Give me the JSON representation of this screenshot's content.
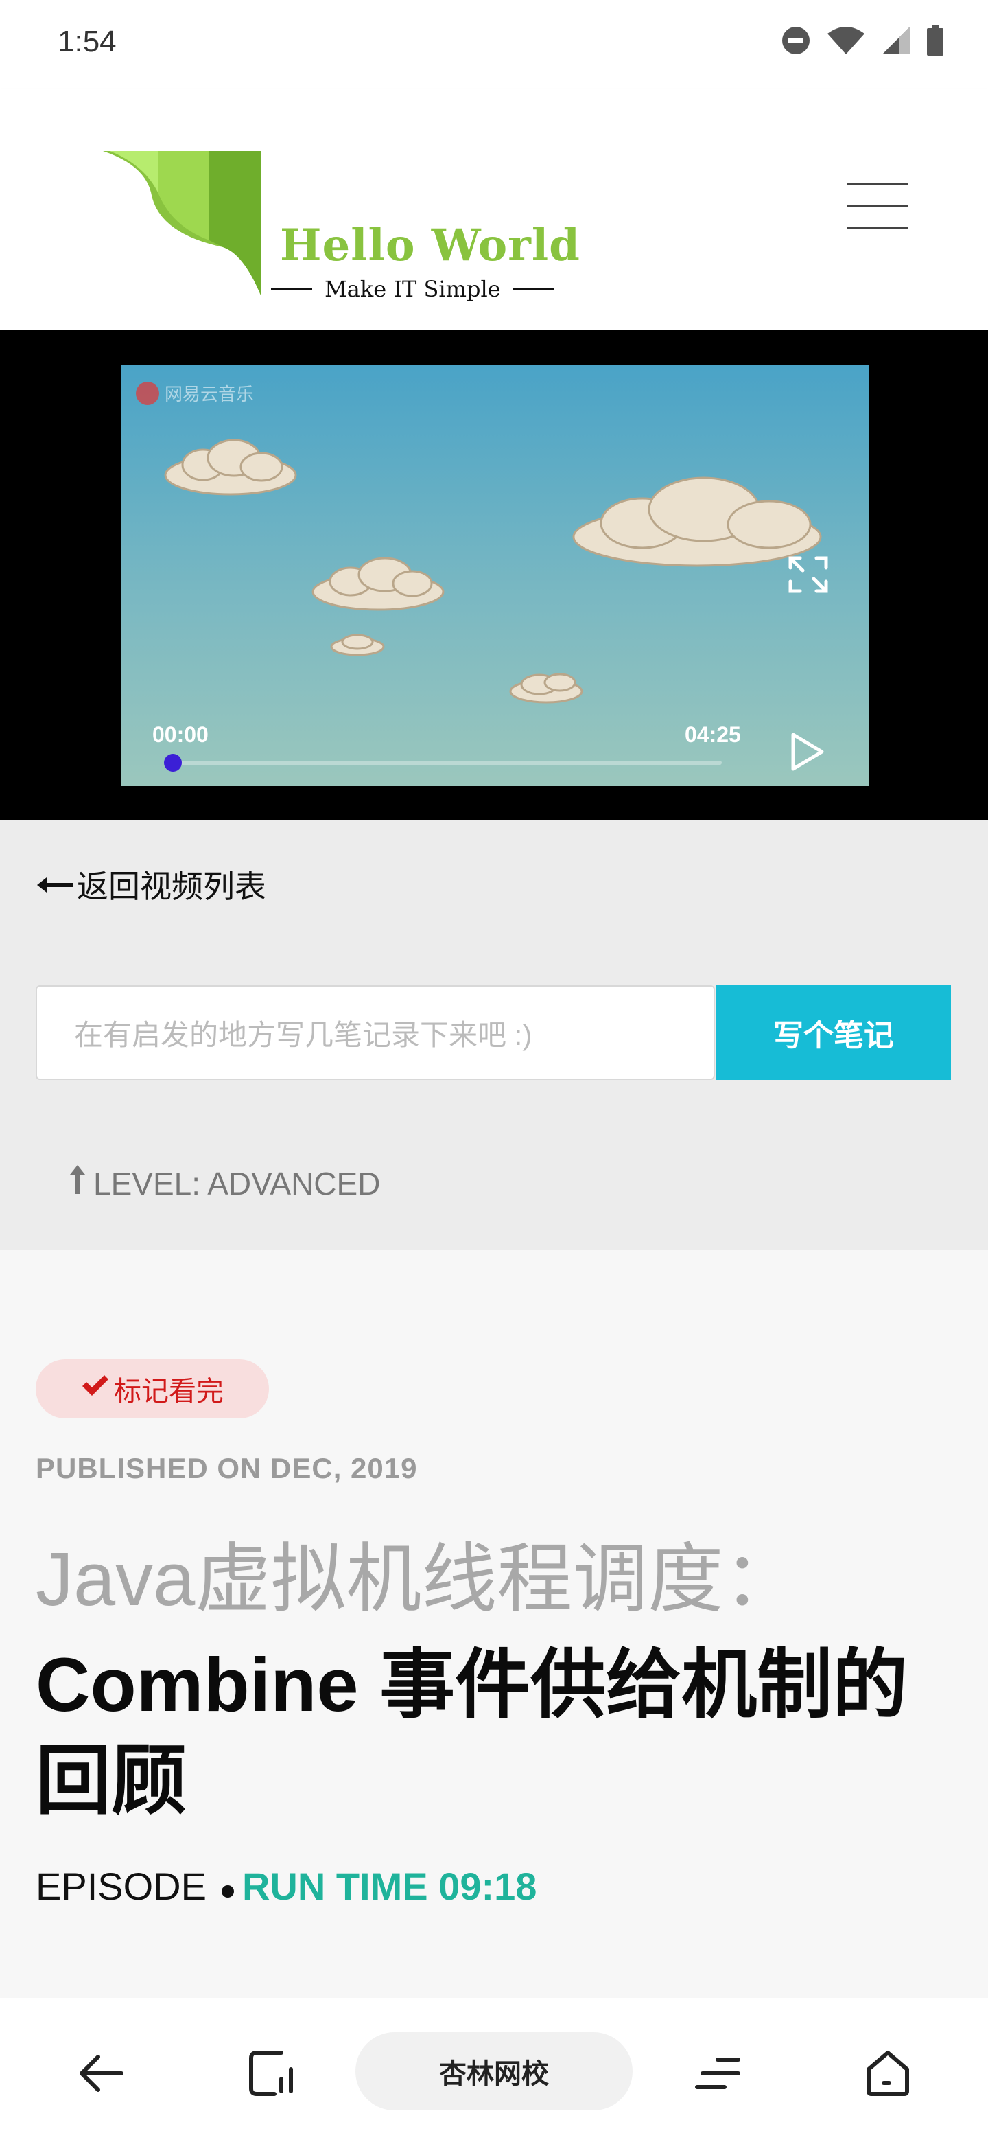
{
  "status_bar": {
    "time": "1:54",
    "icons": [
      "do-not-disturb-icon",
      "wifi-icon",
      "cell-signal-icon",
      "battery-icon"
    ]
  },
  "header": {
    "logo_title": "Hello World",
    "logo_subtitle": "Make IT Simple",
    "menu_icon": "hamburger-menu-icon",
    "brand_color": "#89c33f"
  },
  "video": {
    "watermark": "网易云音乐",
    "current_time": "00:00",
    "total_time": "04:25",
    "progress": 0,
    "icons": [
      "fullscreen-icon",
      "play-icon"
    ]
  },
  "notes": {
    "back_label": "返回视频列表",
    "input_placeholder": "在有启发的地方写几笔记录下来吧 :)",
    "button_label": "写个笔记",
    "button_color": "#17bcd6",
    "level": "LEVEL: ADVANCED"
  },
  "article": {
    "mark_label": "标记看完",
    "published": "PUBLISHED ON DEC, 2019",
    "title_prefix": "Java虚拟机线程调度：",
    "title_main": "Combine 事件供给机制的回顾",
    "episode_label": "EPISODE",
    "run_time": "RUN TIME 09:18",
    "run_time_color": "#1fb39b"
  },
  "bottom_nav": {
    "brand_label": "杏林网校",
    "icons": [
      "back-arrow-icon",
      "tabs-icon",
      "menu-lines-icon",
      "home-icon"
    ]
  }
}
